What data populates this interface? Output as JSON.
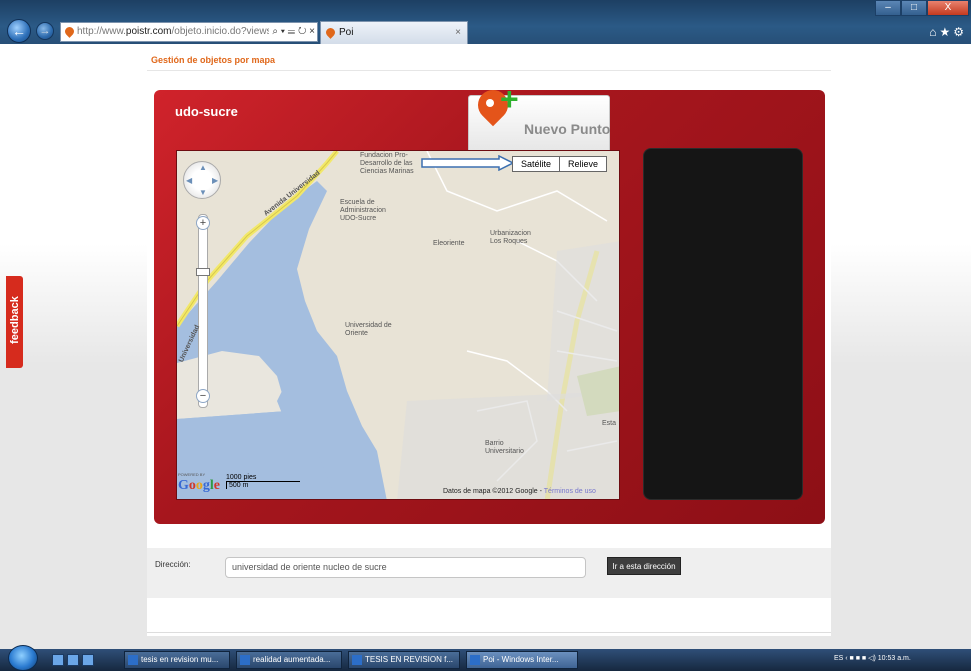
{
  "browser": {
    "address_plain": "http://www.",
    "address_domain": "poistr.com",
    "address_rest": "/objeto.inicio.do?viewsn",
    "address_tools": "⌕ ▾ ☰ ↻ ×",
    "tab_label": "Poi",
    "tab_close": "×",
    "back": "←",
    "forward": "→",
    "win_min": "–",
    "win_max": "□",
    "win_close": "X",
    "right_icons": "⌂★⚙"
  },
  "page": {
    "heading": "Gestión de objetos por mapa",
    "panel_title": "udo-sucre",
    "new_point_label": "Nuevo Punto",
    "feedback_label": "feedback"
  },
  "map": {
    "maptype_satellite": "Satélite",
    "maptype_relief": "Relieve",
    "pan_up": "▲",
    "pan_down": "▼",
    "pan_left": "◀",
    "pan_right": "▶",
    "zoom_in": "+",
    "zoom_out": "−",
    "labels": {
      "fundacion": "Fundacion Pro-Desarrollo de las Ciencias Marinas",
      "escuela": "Escuela de Administracion UDO-Sucre",
      "eleoriente": "Eleoriente",
      "urbanizacion": "Urbanizacion Los Roques",
      "universidad": "Universidad de Oriente",
      "barrio": "Barrio Universitario",
      "avenida1": "Avenida Universidad",
      "avenida2": "Universidad",
      "esta": "Esta"
    },
    "scale_top": "1000 pies",
    "scale_bottom": "500 m",
    "powered_by": "POWERED BY",
    "logo": "Google",
    "attribution": "Datos de mapa ©2012 Google -",
    "terms": "Términos de uso"
  },
  "form": {
    "label": "Dirección:",
    "value": "universidad de oriente nucleo de sucre",
    "button": "Ir a esta dirección"
  },
  "taskbar": {
    "tasks": [
      "tesis en revision mu...",
      "realidad aumentada...",
      "TESIS EN REVISION f...",
      "Poi - Windows Inter..."
    ],
    "tray_text": "ES  ‹  ■  ■ ■  ◁)  10:53 a.m."
  }
}
